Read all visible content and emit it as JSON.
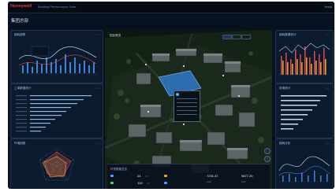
{
  "header": {
    "brand": "Honeywell",
    "subtitle": "Building Performance Suite",
    "user": "Hone"
  },
  "page_title": "集团总部",
  "colors": {
    "background": "#08111f",
    "panel": "#0d1b30",
    "accent_blue": "#4aa3ff",
    "accent_red": "#e04b4b",
    "accent_orange": "#f0a53a",
    "accent_green": "#59d17c"
  },
  "panels": {
    "top_left": {
      "title": "能耗趋势",
      "tool": "•• ⋯"
    },
    "mid_left": {
      "title": "工单数据统计",
      "tool": "•• ⋯"
    },
    "bottom_left": {
      "title": "环境指数",
      "tool": "•• ⋯"
    },
    "top_right": {
      "title": "能耗数据统计",
      "tool": "•• ⋯"
    },
    "mid_right": {
      "title": "用电统计",
      "tool": "•• ⋯"
    },
    "bottom_right": {
      "title": "能耗分析",
      "tool": "•• ⋯"
    }
  },
  "center": {
    "title": "园区概览",
    "kpi_title": "环境数据总览",
    "kpi_items": [
      {
        "value": "24",
        "unit": "m³"
      },
      {
        "value": "120",
        "unit": "m³"
      },
      {
        "value": "7231.47",
        "unit": "kWh"
      },
      {
        "value": "9877.20",
        "unit": "kWh"
      }
    ]
  }
}
